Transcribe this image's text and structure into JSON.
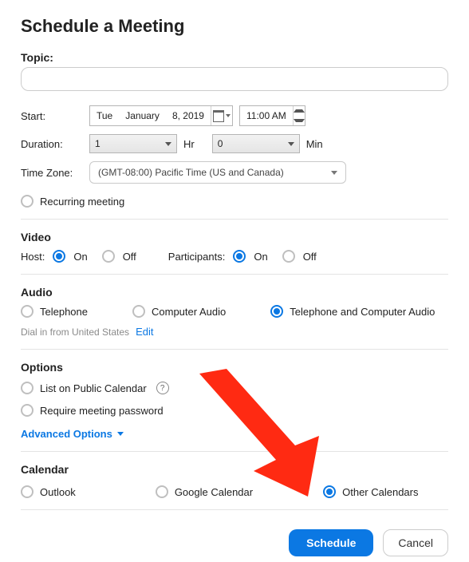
{
  "title": "Schedule a Meeting",
  "topic": {
    "label": "Topic:",
    "value": ""
  },
  "start": {
    "label": "Start:",
    "weekday": "Tue",
    "month": "January",
    "day_year": "8, 2019",
    "time": "11:00 AM"
  },
  "duration": {
    "label": "Duration:",
    "hours": "1",
    "hours_unit": "Hr",
    "mins": "0",
    "mins_unit": "Min"
  },
  "timezone": {
    "label": "Time Zone:",
    "value": "(GMT-08:00) Pacific Time (US and Canada)"
  },
  "recurring": {
    "label": "Recurring meeting",
    "checked": false
  },
  "video": {
    "heading": "Video",
    "host_label": "Host:",
    "participants_label": "Participants:",
    "on_label": "On",
    "off_label": "Off",
    "host_value": "On",
    "participants_value": "On"
  },
  "audio": {
    "heading": "Audio",
    "options": {
      "telephone": "Telephone",
      "computer": "Computer Audio",
      "both": "Telephone and Computer Audio"
    },
    "selected": "both",
    "dial_text": "Dial in from United States",
    "edit_label": "Edit"
  },
  "options": {
    "heading": "Options",
    "public": "List on Public Calendar",
    "password": "Require meeting password",
    "advanced": "Advanced Options"
  },
  "calendar": {
    "heading": "Calendar",
    "outlook": "Outlook",
    "google": "Google Calendar",
    "other": "Other Calendars",
    "selected": "other"
  },
  "buttons": {
    "schedule": "Schedule",
    "cancel": "Cancel"
  }
}
